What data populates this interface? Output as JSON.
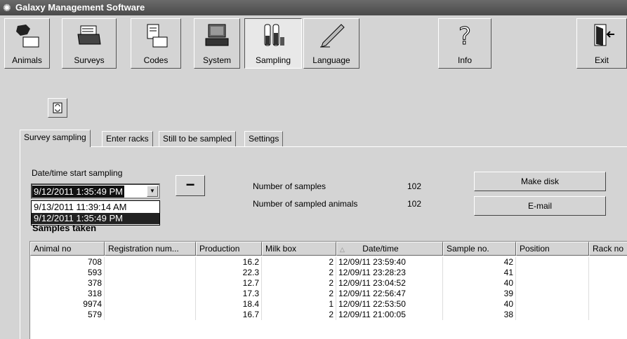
{
  "window": {
    "title": "Galaxy Management Software",
    "icon": "app-logo-icon"
  },
  "toolbar": {
    "buttons": [
      {
        "label": "Animals",
        "icon": "cow-folder-icon"
      },
      {
        "label": "Surveys",
        "icon": "printer-icon"
      },
      {
        "label": "Codes",
        "icon": "document-folder-icon"
      },
      {
        "label": "System",
        "icon": "computer-icon"
      },
      {
        "label": "Sampling",
        "icon": "test-tubes-icon"
      },
      {
        "label": "Language",
        "icon": "pen-icon"
      },
      {
        "label": "Info",
        "icon": "question-icon"
      },
      {
        "label": "Exit",
        "icon": "door-exit-icon"
      }
    ],
    "active": "Sampling"
  },
  "tabs": [
    "Survey sampling",
    "Enter racks",
    "Still to be sampled",
    "Settings"
  ],
  "active_tab": "Survey sampling",
  "sampling": {
    "date_label": "Date/time start sampling",
    "selected_date": "9/12/2011 1:35:49 PM",
    "dropdown_options": [
      "9/13/2011 11:39:14 AM",
      "9/12/2011 1:35:49 PM"
    ],
    "minus_label": "−",
    "num_samples_label": "Number of samples",
    "num_samples_value": "102",
    "num_animals_label": "Number of sampled animals",
    "num_animals_value": "102",
    "make_disk_label": "Make disk",
    "email_label": "E-mail",
    "samples_title": "Samples taken"
  },
  "table": {
    "headers": [
      "Animal no",
      "Registration num...",
      "Production",
      "Milk box",
      "Date/time",
      "Sample no.",
      "Position",
      "Rack no"
    ],
    "sort_indicator": "△",
    "rows": [
      [
        "708",
        "",
        "16.2",
        "2",
        "12/09/11 23:59:40",
        "42",
        "",
        ""
      ],
      [
        "593",
        "",
        "22.3",
        "2",
        "12/09/11 23:28:23",
        "41",
        "",
        ""
      ],
      [
        "378",
        "",
        "12.7",
        "2",
        "12/09/11 23:04:52",
        "40",
        "",
        ""
      ],
      [
        "318",
        "",
        "17.3",
        "2",
        "12/09/11 22:56:47",
        "39",
        "",
        ""
      ],
      [
        "9974",
        "",
        "18.4",
        "1",
        "12/09/11 22:53:50",
        "40",
        "",
        ""
      ],
      [
        "579",
        "",
        "16.7",
        "2",
        "12/09/11 21:00:05",
        "38",
        "",
        ""
      ]
    ]
  },
  "colors": {
    "titlebar": "#555555",
    "window_bg": "#d4d4d4",
    "selection": "#222222"
  }
}
